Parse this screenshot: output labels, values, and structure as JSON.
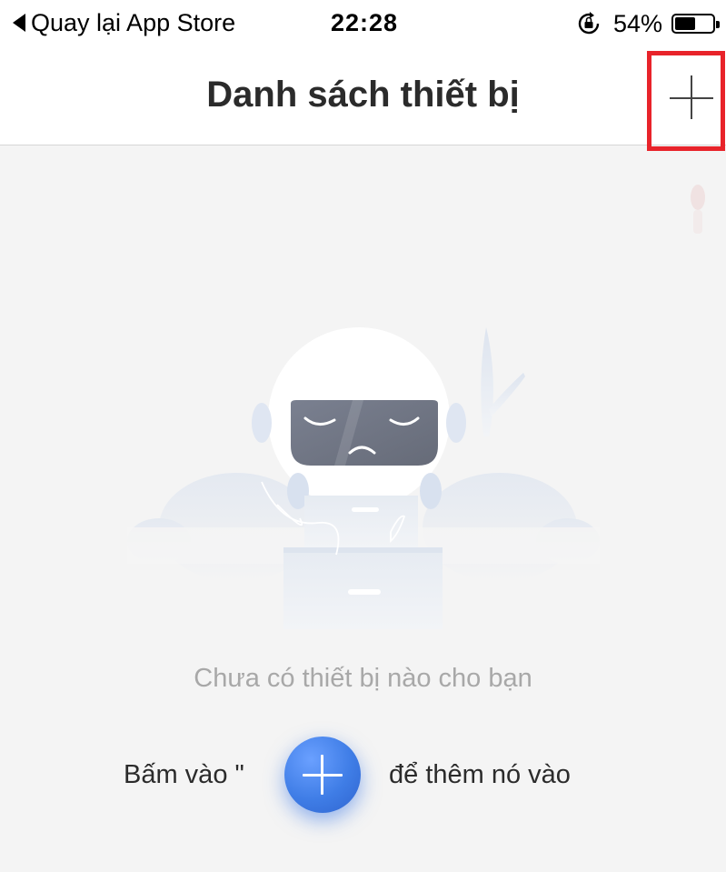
{
  "status_bar": {
    "back_label": "Quay lại App Store",
    "time": "22:28",
    "battery_percent_text": "54%",
    "battery_level": 0.54
  },
  "nav": {
    "title": "Danh sách thiết bị",
    "add_icon": "plus-icon"
  },
  "empty_state": {
    "message": "Chưa có thiết bị nào cho bạn",
    "hint_prefix": "Bấm vào \"",
    "hint_suffix": "để thêm nó vào",
    "hint_icon": "plus-icon"
  },
  "colors": {
    "background": "#f4f4f4",
    "highlight_box": "#e8232a",
    "accent_blue": "#3f7de6",
    "muted_text": "#a8a8a8"
  }
}
